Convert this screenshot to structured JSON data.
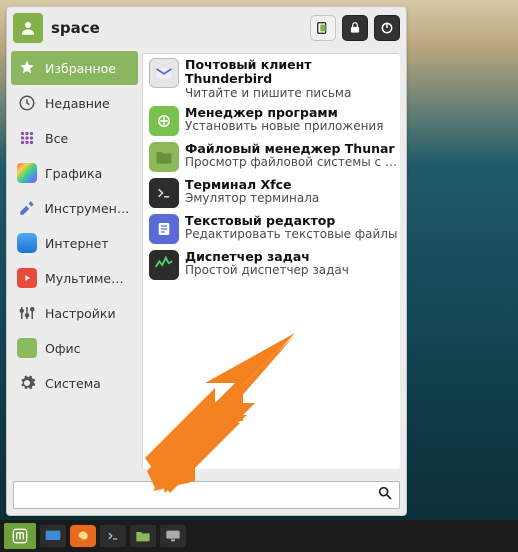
{
  "header": {
    "username": "space",
    "buttons": {
      "logout": "logout-icon",
      "lock": "lock-icon",
      "power": "power-icon"
    }
  },
  "sidebar": {
    "items": [
      {
        "label": "Избранное",
        "active": true,
        "icon": "star"
      },
      {
        "label": "Недавние",
        "active": false,
        "icon": "clock"
      },
      {
        "label": "Все",
        "active": false,
        "icon": "grid"
      },
      {
        "label": "Графика",
        "active": false,
        "icon": "palette"
      },
      {
        "label": "Инструменты",
        "active": false,
        "icon": "tools"
      },
      {
        "label": "Интернет",
        "active": false,
        "icon": "globe"
      },
      {
        "label": "Мультимедиа",
        "active": false,
        "icon": "play"
      },
      {
        "label": "Настройки",
        "active": false,
        "icon": "sliders"
      },
      {
        "label": "Офис",
        "active": false,
        "icon": "office"
      },
      {
        "label": "Система",
        "active": false,
        "icon": "gear"
      }
    ]
  },
  "apps": [
    {
      "title": "Почтовый клиент Thunderbird",
      "descr": "Читайте и пишите письма",
      "icon": "mail"
    },
    {
      "title": "Менеджер программ",
      "descr": "Установить новые приложения",
      "icon": "store"
    },
    {
      "title": "Файловый менеджер Thunar",
      "descr": "Просмотр файловой системы с …",
      "icon": "folder"
    },
    {
      "title": "Терминал Xfce",
      "descr": "Эмулятор терминала",
      "icon": "terminal"
    },
    {
      "title": "Текстовый редактор",
      "descr": "Редактировать текстовые файлы",
      "icon": "text"
    },
    {
      "title": "Диспетчер задач",
      "descr": "Простой диспетчер задач",
      "icon": "tasks"
    }
  ],
  "search": {
    "value": "",
    "placeholder": ""
  }
}
